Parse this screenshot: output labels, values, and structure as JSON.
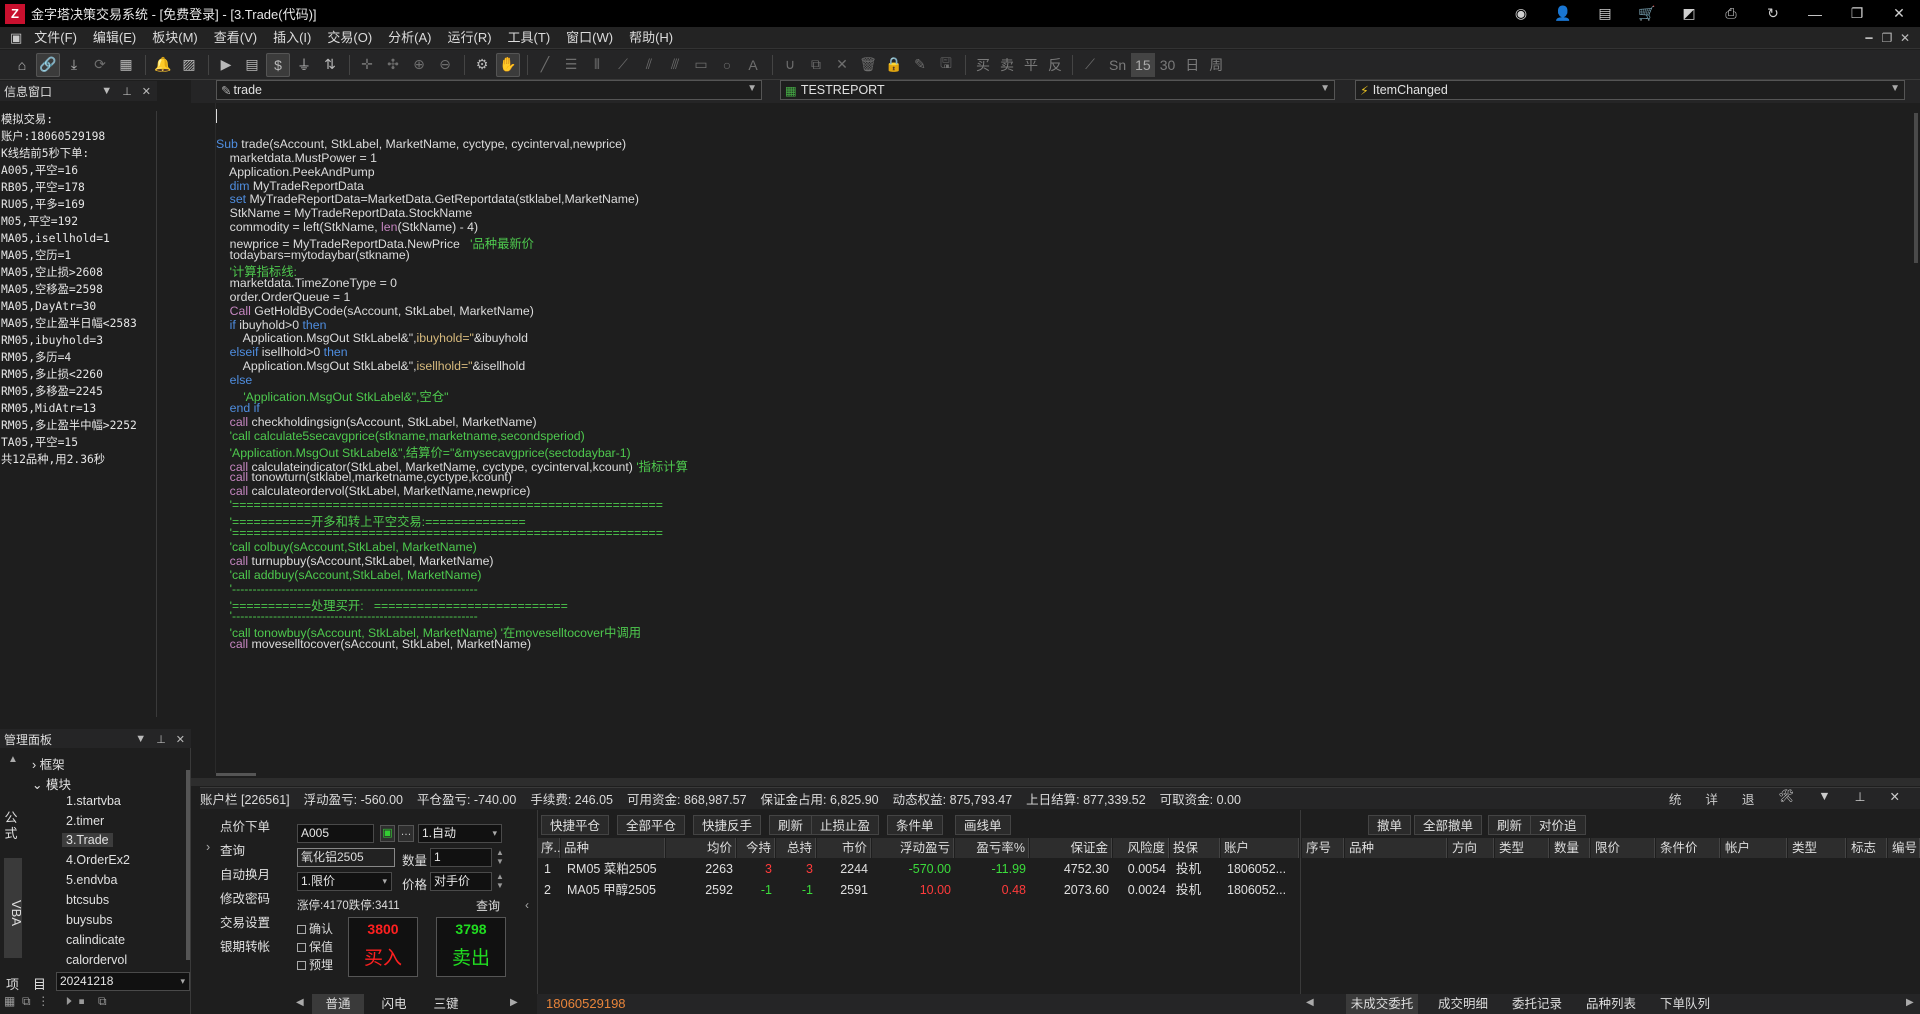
{
  "window": {
    "title": "金字塔决策交易系统 - [免费登录] - [3.Trade(代码)]",
    "logo": "Z"
  },
  "menu": [
    "文件(F)",
    "编辑(E)",
    "板块(M)",
    "查看(V)",
    "插入(I)",
    "交易(O)",
    "分析(A)",
    "运行(R)",
    "工具(T)",
    "窗口(W)",
    "帮助(H)"
  ],
  "toolbar_text": [
    "买",
    "卖",
    "平",
    "反",
    "Sn",
    "15",
    "30",
    "日",
    "周"
  ],
  "info_panel": {
    "title": "信息窗口",
    "lines": [
      "模拟交易:",
      "账户:18060529198",
      "K线结前5秒下单:",
      "A005,平空=16",
      "RB05,平空=178",
      "RU05,平多=169",
      "M05,平空=192",
      "MA05,isellhold=1",
      "MA05,空历=1",
      "MA05,空止损>2608",
      "MA05,空移盈=2598",
      "MA05,DayAtr=30",
      "MA05,空止盈半日幅<2583",
      "RM05,ibuyhold=3",
      "RM05,多历=4",
      "RM05,多止损<2260",
      "RM05,多移盈=2245",
      "RM05,MidAtr=13",
      "RM05,多止盈半中幅>2252",
      "TA05,平空=15",
      "共12品种,用2.36秒"
    ]
  },
  "manage_panel": {
    "title": "管理面板",
    "vtabs": [
      "公式",
      "VBA",
      "项目"
    ],
    "tree": [
      "框架",
      "模块",
      "1.startvba",
      "2.timer",
      "3.Trade",
      "4.OrderEx2",
      "5.endvba",
      "btcsubs",
      "buysubs",
      "calindicate",
      "calordervol"
    ],
    "date": "20241218"
  },
  "editor": {
    "combo1": "trade",
    "combo2": "TESTREPORT",
    "combo3": "ItemChanged",
    "lines": [
      [],
      [],
      [
        [
          "kw",
          "Sub "
        ],
        [
          "",
          "trade(sAccount, StkLabel, MarketName, cyctype, cycinterval,newprice)"
        ]
      ],
      [
        [
          "",
          "    marketdata.MustPower = 1"
        ]
      ],
      [
        [
          "",
          "    Application.PeekAndPump"
        ]
      ],
      [
        [
          "kw",
          "    dim "
        ],
        [
          "",
          "MyTradeReportData"
        ]
      ],
      [
        [
          "kw",
          "    set "
        ],
        [
          "",
          "MyTradeReportData=MarketData.GetReportdata(stklabel,MarketName)"
        ]
      ],
      [
        [
          "",
          "    StkName = MyTradeReportData.StockName"
        ]
      ],
      [
        [
          "",
          "    commodity = left(StkName, "
        ],
        [
          "ki",
          "len"
        ],
        [
          "",
          "(StkName) - 4)"
        ]
      ],
      [
        [
          "",
          "    newprice = MyTradeReportData.NewPrice   "
        ],
        [
          "cm",
          "'品种最新价"
        ]
      ],
      [
        [
          "",
          "    todaybars=mytodaybar(stkname)"
        ]
      ],
      [
        [
          "cm",
          "    '计算指标线:"
        ]
      ],
      [
        [
          "",
          "    marketdata.TimeZoneType = 0"
        ]
      ],
      [
        [
          "",
          "    order.OrderQueue = 1"
        ]
      ],
      [
        [
          "ki",
          "    Call "
        ],
        [
          "",
          "GetHoldByCode(sAccount, StkLabel, MarketName)"
        ]
      ],
      [
        [
          "kw",
          "    if "
        ],
        [
          "",
          "ibuyhold>0 "
        ],
        [
          "kw",
          "then"
        ]
      ],
      [
        [
          "",
          "        Application.MsgOut StkLabel&\","
        ],
        [
          "st",
          "ibuyhold=\""
        ],
        [
          "",
          "&ibuyhold"
        ]
      ],
      [
        [
          "kw",
          "    elseif "
        ],
        [
          "",
          "isellhold>0 "
        ],
        [
          "kw",
          "then"
        ]
      ],
      [
        [
          "",
          "        Application.MsgOut StkLabel&\","
        ],
        [
          "st",
          "isellhold=\""
        ],
        [
          "",
          "&isellhold"
        ]
      ],
      [
        [
          "kw",
          "    else"
        ]
      ],
      [
        [
          "cm",
          "        'Application.MsgOut StkLabel&\",空仓\""
        ]
      ],
      [
        [
          "kw",
          "    end if"
        ]
      ],
      [
        [
          "ki",
          "    call "
        ],
        [
          "",
          "checkholdingsign(sAccount, StkLabel, MarketName)"
        ]
      ],
      [
        [
          "cm",
          "    'call calculate5secavgprice(stkname,marketname,secondsperiod)"
        ]
      ],
      [
        [
          "cm",
          "    'Application.MsgOut StkLabel&\",结算价=\"&mysecavgprice(sectodaybar-1)"
        ]
      ],
      [
        [
          "ki",
          "    call "
        ],
        [
          "",
          "calculateindicator(StkLabel, MarketName, cyctype, cycinterval,kcount) "
        ],
        [
          "cm",
          "'指标计算"
        ]
      ],
      [
        [
          "ki",
          "    call "
        ],
        [
          "",
          "tonowturn(stklabel,marketname,cyctype,kcount)"
        ]
      ],
      [
        [
          "ki",
          "    call "
        ],
        [
          "",
          "calculateordervol(StkLabel, MarketName,newprice)"
        ]
      ],
      [
        [
          "cm",
          "    '============================================================"
        ]
      ],
      [
        [
          "cm",
          "    '===========开多和转上平空交易:=============="
        ]
      ],
      [
        [
          "cm",
          "    '============================================================"
        ]
      ],
      [
        [
          "cm",
          "    'call colbuy(sAccount,StkLabel, MarketName)"
        ]
      ],
      [
        [
          "ki",
          "    call "
        ],
        [
          "",
          "turnupbuy(sAccount,StkLabel, MarketName)"
        ]
      ],
      [
        [
          "cm",
          "    'call addbuy(sAccount,StkLabel, MarketName)"
        ]
      ],
      [
        [
          "cm",
          "    '------------------------------------------------------------"
        ]
      ],
      [
        [
          "cm",
          "    '===========处理买开:   ==========================="
        ]
      ],
      [
        [
          "cm",
          "    '------------------------------------------------------------"
        ]
      ],
      [
        [
          "cm",
          "    'call tonowbuy(sAccount, StkLabel, MarketName) '在moveselltocover中调用"
        ]
      ],
      [
        [
          "ki",
          "    call "
        ],
        [
          "",
          "moveselltocover(sAccount, StkLabel, MarketName)"
        ]
      ]
    ]
  },
  "account_bar": {
    "account": "账户栏 [226561]",
    "float_pl": "浮动盈亏: -560.00",
    "close_pl": "平仓盈亏: -740.00",
    "fee": "手续费: 246.05",
    "available": "可用资金: 868,987.57",
    "margin": "保证金占用: 6,825.90",
    "equity": "动态权益: 875,793.47",
    "settle": "上日结算: 877,339.52",
    "withdraw": "可取资金: 0.00",
    "right": [
      "统",
      "详",
      "退"
    ]
  },
  "order_panel": {
    "menu": [
      "点价下单",
      "查询",
      "自动换月",
      "修改密码",
      "交易设置",
      "银期转帐"
    ],
    "code": "A005",
    "mode": "1.自动",
    "name": "氧化铝2505",
    "qty_label": "数量",
    "qty": "1",
    "pricetype": "1.限价",
    "price_label": "价格",
    "price": "对手价",
    "limits": "涨停:4170跌停:3411",
    "query_btn": "查询",
    "checks": [
      "确认",
      "保值",
      "预埋"
    ],
    "buy_price": "3800",
    "buy_label": "买入",
    "sell_price": "3798",
    "sell_label": "卖出",
    "tabs": [
      "普通",
      "闪电",
      "三键"
    ],
    "status_account": "18060529198",
    "colors": {
      "buy": "#ff2020",
      "sell": "#20dc20"
    }
  },
  "positions": {
    "buttons": [
      "快捷平仓",
      "全部平仓",
      "快捷反手",
      "刷新",
      "止损止盈",
      "条件单",
      "画线单"
    ],
    "headers": [
      "序..",
      "品种",
      "均价",
      "今持",
      "总持",
      "市价",
      "浮动盈亏",
      "盈亏率%",
      "保证金",
      "风险度",
      "投保",
      "账户"
    ],
    "rows": [
      [
        "1",
        "RM05 菜粕2505",
        "2263",
        "3",
        "3",
        "2244",
        "-570.00",
        "-11.99",
        "4752.30",
        "0.0054",
        "投机",
        "1806052..."
      ],
      [
        "2",
        "MA05 甲醇2505",
        "2592",
        "-1",
        "-1",
        "2591",
        "10.00",
        "0.48",
        "2073.60",
        "0.0024",
        "投机",
        "1806052..."
      ]
    ]
  },
  "orders": {
    "buttons": [
      "撤单",
      "全部撤单",
      "刷新",
      "对价追"
    ],
    "headers": [
      "序号",
      "品种",
      "方向",
      "类型",
      "数量",
      "限价",
      "条件价",
      "帐户",
      "类型",
      "标志",
      "编号"
    ],
    "tabs": [
      "未成交委托",
      "成交明细",
      "委托记录",
      "品种列表",
      "下单队列"
    ]
  }
}
